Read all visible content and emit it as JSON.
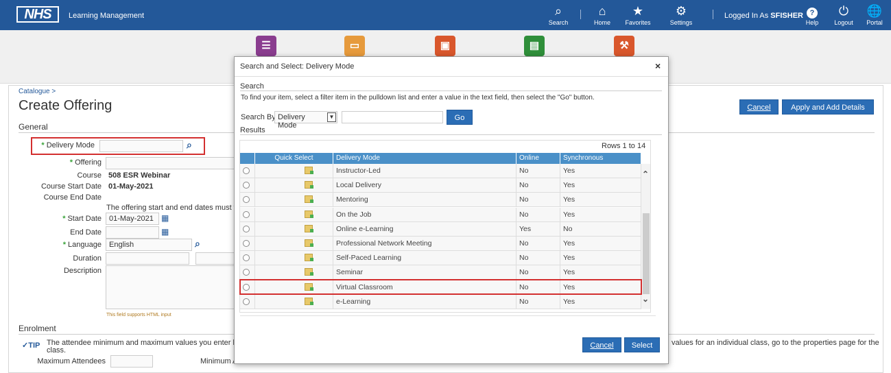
{
  "header": {
    "logo": "NHS",
    "app_title": "Learning Management",
    "search_label": "Search",
    "home_label": "Home",
    "favorites_label": "Favorites",
    "settings_label": "Settings",
    "logged_in_prefix": "Logged In As",
    "user": "SFISHER",
    "help_label": "Help",
    "logout_label": "Logout",
    "portal_label": "Portal"
  },
  "nav_tiles": [
    {
      "icon": "books-icon",
      "color": "#8a3d8f"
    },
    {
      "icon": "presentation-icon",
      "color": "#e69a3c"
    },
    {
      "icon": "id-card-icon",
      "color": "#d9572c"
    },
    {
      "icon": "folders-icon",
      "color": "#2f8f3a"
    },
    {
      "icon": "tools-icon",
      "color": "#d9572c"
    }
  ],
  "breadcrumb": "Catalogue >",
  "page_title": "Create Offering",
  "buttons": {
    "cancel": "Cancel",
    "apply_add": "Apply and Add Details"
  },
  "general": {
    "heading": "General",
    "delivery_mode_label": "Delivery Mode",
    "offering_label": "Offering",
    "course_label": "Course",
    "course_value": "508 ESR Webinar",
    "course_start_label": "Course Start Date",
    "course_start_value": "01-May-2021",
    "course_end_label": "Course End Date",
    "dates_note": "The offering start and end dates must fall",
    "start_date_label": "Start Date",
    "start_date_value": "01-May-2021",
    "end_date_label": "End Date",
    "language_label": "Language",
    "language_value": "English",
    "duration_label": "Duration",
    "description_label": "Description",
    "html_note": "This field supports HTML input"
  },
  "enrolment": {
    "heading": "Enrolment",
    "tip_label": "TIP",
    "tip_text_1": "The attendee minimum and maximum values you enter here",
    "tip_text_2": "class.",
    "tip_text_right": "values for an individual class, go to the properties page for the",
    "max_attendees_label": "Maximum Attendees",
    "min_attendees_label": "Minimum A"
  },
  "modal": {
    "title": "Search and Select: Delivery Mode",
    "close": "×",
    "search_heading": "Search",
    "instructions": "To find your item, select a filter item in the pulldown list and enter a value in the text field, then select the \"Go\" button.",
    "search_by_label": "Search By",
    "search_by_value": "Delivery Mode",
    "go_label": "Go",
    "results_heading": "Results",
    "rows_info": "Rows 1 to 14",
    "columns": [
      "Quick Select",
      "Delivery Mode",
      "Online",
      "Synchronous"
    ],
    "rows": [
      {
        "mode": "Instructor-Led",
        "online": "No",
        "sync": "Yes"
      },
      {
        "mode": "Local Delivery",
        "online": "No",
        "sync": "Yes"
      },
      {
        "mode": "Mentoring",
        "online": "No",
        "sync": "Yes"
      },
      {
        "mode": "On the Job",
        "online": "No",
        "sync": "Yes"
      },
      {
        "mode": "Online e-Learning",
        "online": "Yes",
        "sync": "No"
      },
      {
        "mode": "Professional Network Meeting",
        "online": "No",
        "sync": "Yes"
      },
      {
        "mode": "Self-Paced Learning",
        "online": "No",
        "sync": "Yes"
      },
      {
        "mode": "Seminar",
        "online": "No",
        "sync": "Yes"
      },
      {
        "mode": "Virtual Classroom",
        "online": "No",
        "sync": "Yes"
      },
      {
        "mode": "e-Learning",
        "online": "No",
        "sync": "Yes"
      }
    ],
    "cancel_label": "Cancel",
    "select_label": "Select"
  }
}
